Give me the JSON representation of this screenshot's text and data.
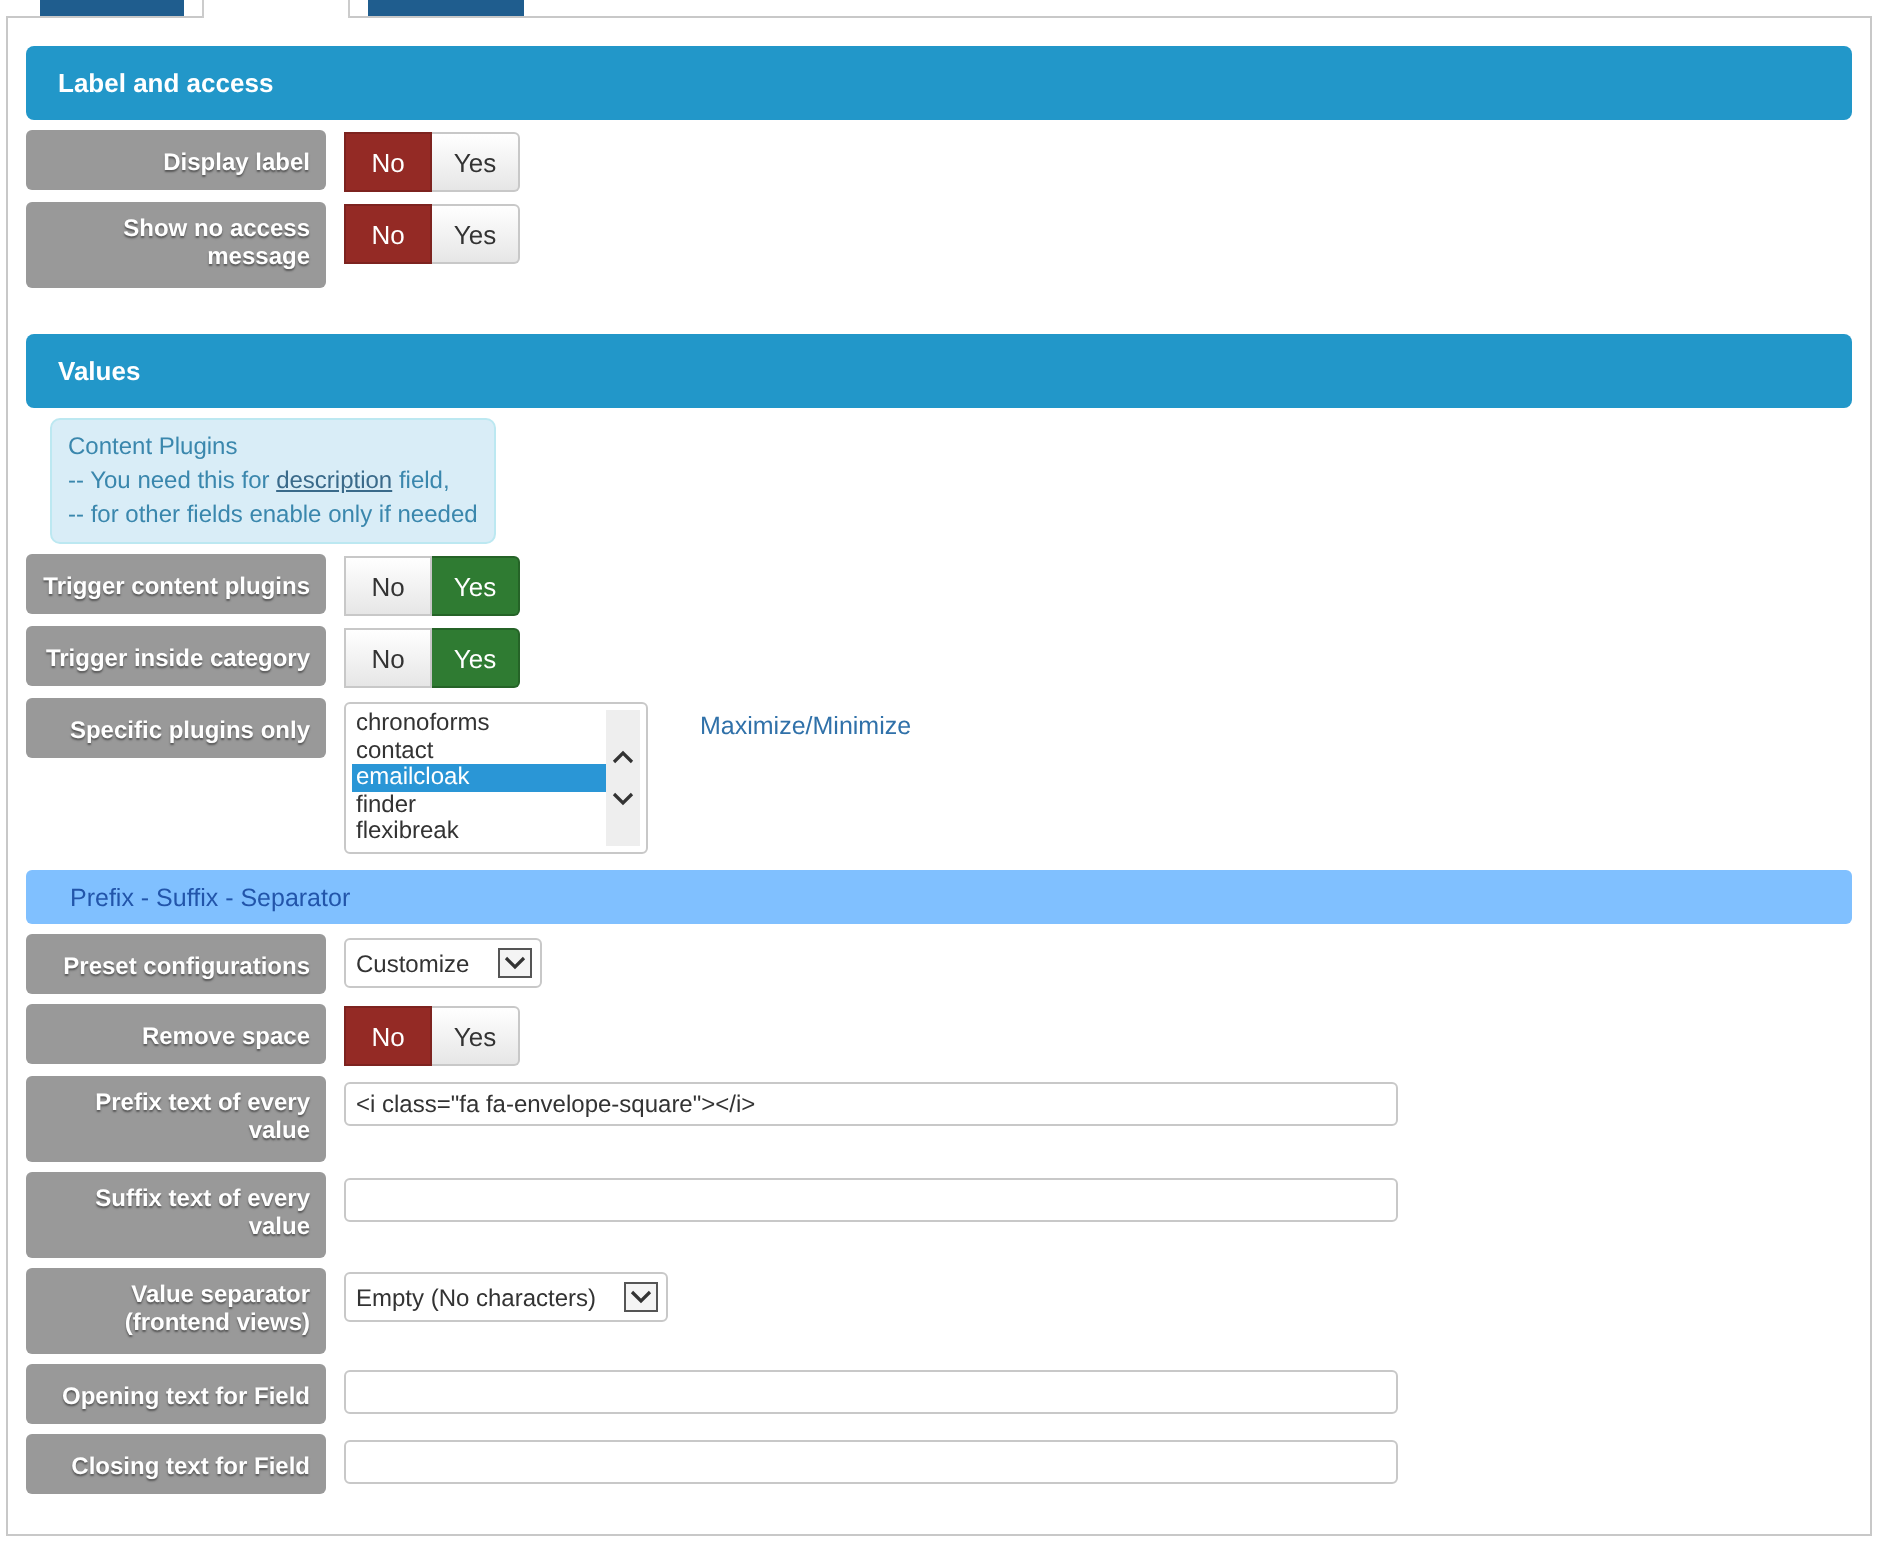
{
  "tabs": [
    {
      "selected": false
    },
    {
      "selected": true
    },
    {
      "selected": false
    }
  ],
  "sections": [
    {
      "kind": "header",
      "title": "Label and access"
    },
    {
      "kind": "toggle",
      "label": "Display label",
      "options": [
        {
          "text": "No",
          "selected": true
        },
        {
          "text": "Yes",
          "selected": false
        }
      ]
    },
    {
      "kind": "toggle",
      "label": "Show no access message",
      "options": [
        {
          "text": "No",
          "selected": true
        },
        {
          "text": "Yes",
          "selected": false
        }
      ]
    },
    {
      "kind": "header",
      "title": "Values"
    },
    {
      "kind": "note",
      "title": "Content Plugins",
      "lines": [
        {
          "before": "-- You need this for ",
          "link": "description",
          "after": " field,"
        },
        {
          "before": "-- for other fields enable only if needed"
        }
      ]
    },
    {
      "kind": "toggle",
      "label": "Trigger content plugins",
      "options": [
        {
          "text": "No",
          "selected": false
        },
        {
          "text": "Yes",
          "selected": true
        }
      ]
    },
    {
      "kind": "toggle",
      "label": "Trigger inside category",
      "options": [
        {
          "text": "No",
          "selected": false
        },
        {
          "text": "Yes",
          "selected": true
        }
      ]
    },
    {
      "kind": "listbox",
      "label": "Specific plugins only",
      "items": [
        {
          "text": "chronoforms",
          "selected": false
        },
        {
          "text": "contact",
          "selected": false
        },
        {
          "text": "emailcloak",
          "selected": true
        },
        {
          "text": "finder",
          "selected": false
        },
        {
          "text": "flexibreak",
          "selected": false
        }
      ],
      "link": "Maximize/Minimize"
    },
    {
      "kind": "subheader",
      "title": "Prefix - Suffix - Separator"
    },
    {
      "kind": "select",
      "label": "Preset configurations",
      "value": "Customize"
    },
    {
      "kind": "toggle",
      "label": "Remove space",
      "options": [
        {
          "text": "No",
          "selected": true
        },
        {
          "text": "Yes",
          "selected": false
        }
      ]
    },
    {
      "kind": "text",
      "label": "Prefix text of every value",
      "value": "<i class=\"fa fa-envelope-square\"></i>"
    },
    {
      "kind": "text",
      "label": "Suffix text of every value"
    },
    {
      "kind": "select",
      "label": "Value separator (frontend views)",
      "value": "Empty (No characters)"
    },
    {
      "kind": "text",
      "label": "Opening text for Field"
    },
    {
      "kind": "text",
      "label": "Closing text for Field"
    }
  ]
}
